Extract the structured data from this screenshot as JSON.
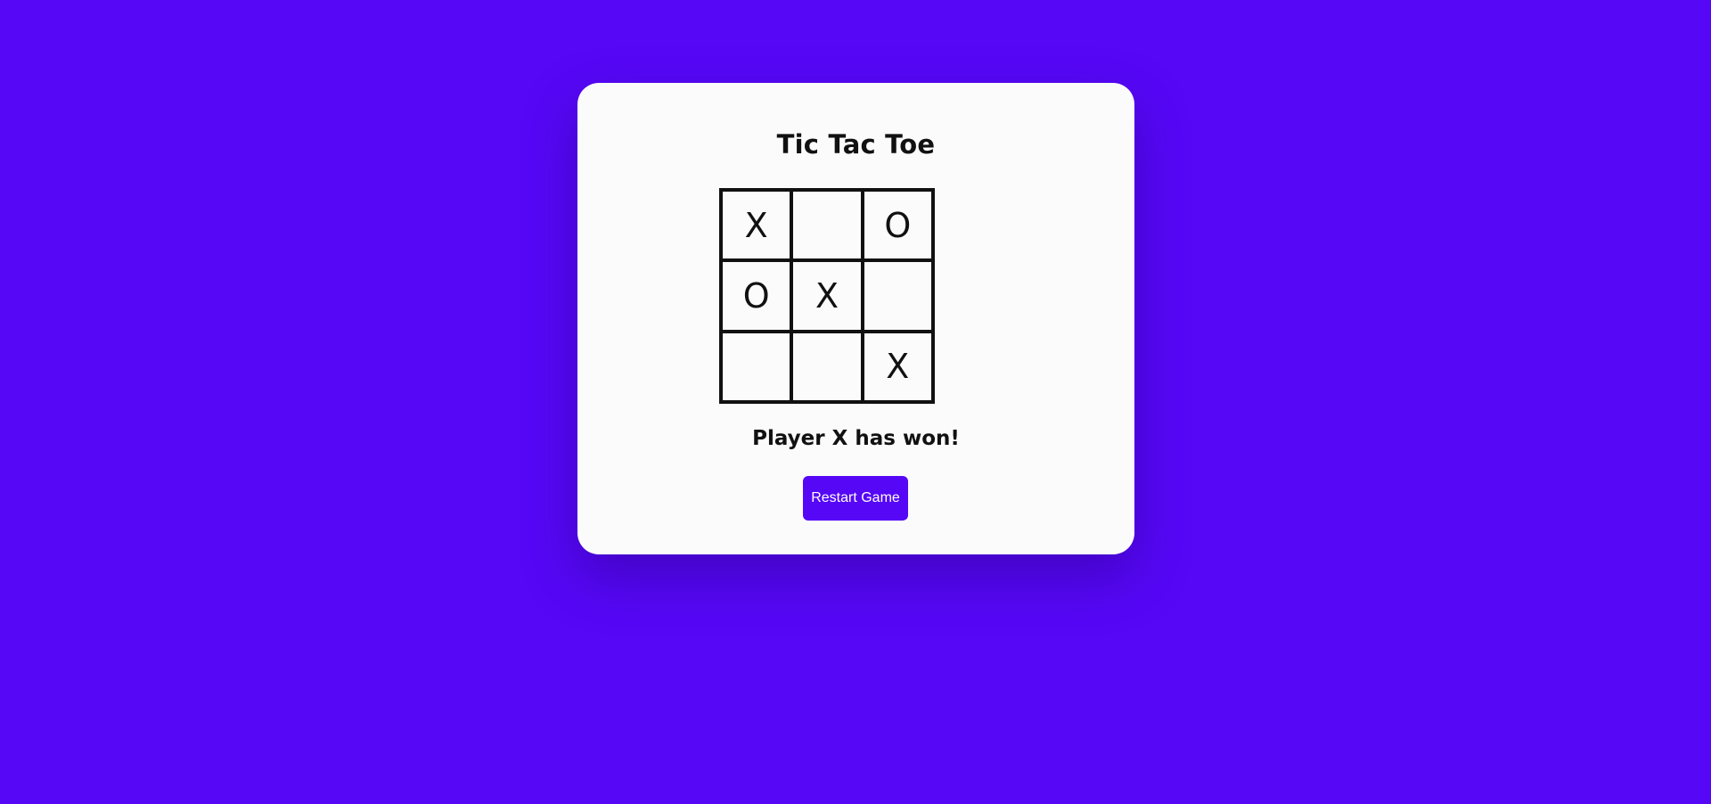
{
  "game": {
    "title": "Tic Tac Toe",
    "board": [
      "X",
      "",
      "O",
      "O",
      "X",
      "",
      "",
      "",
      "X"
    ],
    "status": "Player X has won!",
    "restart_label": "Restart Game"
  },
  "colors": {
    "background": "#5607f6",
    "card": "#fbfbfb",
    "button": "#5607f6",
    "grid": "#111111"
  }
}
